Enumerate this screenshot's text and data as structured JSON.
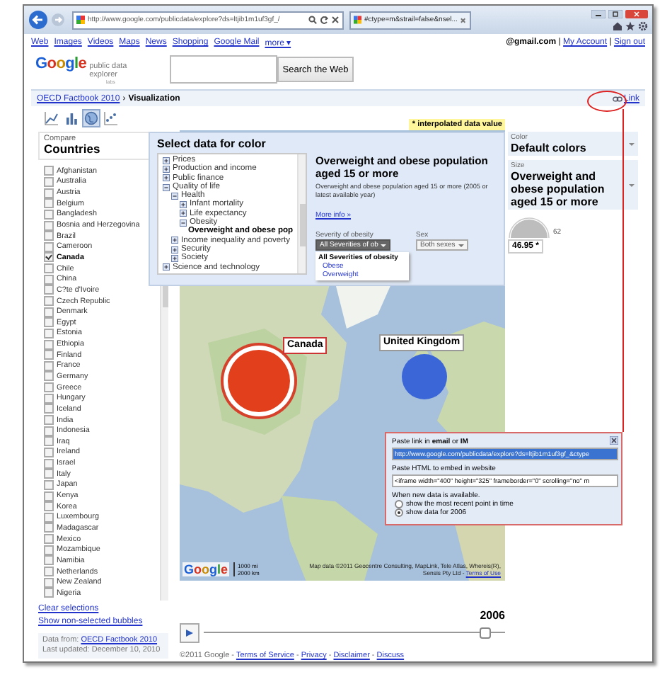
{
  "browser": {
    "address": "http://www.google.com/publicdata/explore?ds=ltjib1m1uf3gf_/",
    "tab": "#ctype=m&strail=false&nsel..."
  },
  "nav_links": [
    "Web",
    "Images",
    "Videos",
    "Maps",
    "News",
    "Shopping",
    "Google Mail",
    "more ▾"
  ],
  "account": {
    "email": "@gmail.com",
    "separator": "|",
    "links": [
      "My Account",
      "Sign out"
    ]
  },
  "header": {
    "logo": "Google",
    "product": "public data explorer",
    "badge": "labs",
    "search_button": "Search the Web"
  },
  "breadcrumb": {
    "link": "OECD Factbook 2010",
    "separator": "›",
    "current": "Visualization",
    "share_link": "Link"
  },
  "chart_types": [
    {
      "kind": "line",
      "selected": false
    },
    {
      "kind": "bar",
      "selected": false
    },
    {
      "kind": "map",
      "selected": true
    },
    {
      "kind": "scatter",
      "selected": false
    }
  ],
  "compare": {
    "label": "Compare",
    "title": "Countries"
  },
  "countries": [
    {
      "name": "Afghanistan",
      "checked": false
    },
    {
      "name": "Australia",
      "checked": false
    },
    {
      "name": "Austria",
      "checked": false
    },
    {
      "name": "Belgium",
      "checked": false
    },
    {
      "name": "Bangladesh",
      "checked": false
    },
    {
      "name": "Bosnia and Herzegovina",
      "checked": false
    },
    {
      "name": "Brazil",
      "checked": false
    },
    {
      "name": "Cameroon",
      "checked": false
    },
    {
      "name": "Canada",
      "checked": true
    },
    {
      "name": "Chile",
      "checked": false
    },
    {
      "name": "China",
      "checked": false
    },
    {
      "name": "C?te d'Ivoire",
      "checked": false
    },
    {
      "name": "Czech Republic",
      "checked": false
    },
    {
      "name": "Denmark",
      "checked": false
    },
    {
      "name": "Egypt",
      "checked": false
    },
    {
      "name": "Estonia",
      "checked": false
    },
    {
      "name": "Ethiopia",
      "checked": false
    },
    {
      "name": "Finland",
      "checked": false
    },
    {
      "name": "France",
      "checked": false
    },
    {
      "name": "Germany",
      "checked": false
    },
    {
      "name": "Greece",
      "checked": false
    },
    {
      "name": "Hungary",
      "checked": false
    },
    {
      "name": "Iceland",
      "checked": false
    },
    {
      "name": "India",
      "checked": false
    },
    {
      "name": "Indonesia",
      "checked": false
    },
    {
      "name": "Iraq",
      "checked": false
    },
    {
      "name": "Ireland",
      "checked": false
    },
    {
      "name": "Israel",
      "checked": false
    },
    {
      "name": "Italy",
      "checked": false
    },
    {
      "name": "Japan",
      "checked": false
    },
    {
      "name": "Kenya",
      "checked": false
    },
    {
      "name": "Korea",
      "checked": false
    },
    {
      "name": "Luxembourg",
      "checked": false
    },
    {
      "name": "Madagascar",
      "checked": false
    },
    {
      "name": "Mexico",
      "checked": false
    },
    {
      "name": "Mozambique",
      "checked": false
    },
    {
      "name": "Namibia",
      "checked": false
    },
    {
      "name": "Netherlands",
      "checked": false
    },
    {
      "name": "New Zealand",
      "checked": false
    },
    {
      "name": "Nigeria",
      "checked": false
    }
  ],
  "list_links": [
    "Clear selections",
    "Show non-selected bubbles"
  ],
  "source": {
    "label": "Data from:",
    "link": "OECD Factbook 2010",
    "updated": "Last updated: December 10, 2010"
  },
  "interpolated_note": "* interpolated data value",
  "data_picker": {
    "title": "Select data for color",
    "tree": [
      {
        "label": "Prices",
        "expanded": false,
        "selected": false
      },
      {
        "label": "Production and income",
        "expanded": false,
        "selected": false
      },
      {
        "label": "Public finance",
        "expanded": false,
        "selected": false
      },
      {
        "label": "Quality of life",
        "expanded": true,
        "selected": false,
        "children": [
          {
            "label": "Health",
            "expanded": true,
            "selected": false,
            "children": [
              {
                "label": "Infant mortality",
                "expanded": false,
                "selected": false
              },
              {
                "label": "Life expectancy",
                "expanded": false,
                "selected": false
              },
              {
                "label": "Obesity",
                "expanded": true,
                "selected": false,
                "children": [
                  {
                    "label": "Overweight and obese pop",
                    "selected": true
                  }
                ]
              }
            ]
          },
          {
            "label": "Income inequality and poverty",
            "expanded": false,
            "selected": false
          },
          {
            "label": "Security",
            "expanded": false,
            "selected": false
          },
          {
            "label": "Society",
            "expanded": false,
            "selected": false
          }
        ]
      },
      {
        "label": "Science and technology",
        "expanded": false,
        "selected": false
      }
    ],
    "metric_title": "Overweight and obese population aged 15 or more",
    "description": "Overweight and obese population aged 15 or more (2005 or latest available year)",
    "more_info": "More info »",
    "filters": [
      {
        "label": "Severity of obesity",
        "value": "All Severities of ob",
        "open": true
      },
      {
        "label": "Sex",
        "value": "Both sexes",
        "open": false
      }
    ],
    "options": [
      {
        "label": "All Severities of obesity",
        "selected": true
      },
      {
        "label": "Obese",
        "selected": false
      },
      {
        "label": "Overweight",
        "selected": false
      }
    ]
  },
  "bubbles": [
    {
      "label": "Canada",
      "color": "#e2401d",
      "selected": true
    },
    {
      "label": "United Kingdom",
      "color": "#3a66d8",
      "selected": false
    }
  ],
  "map": {
    "scale": [
      "1000 mi",
      "2000 km"
    ],
    "logo": "Google",
    "attribution": "Map data ©2011 Geocentre Consulting, MapLink, Tele Atlas, Whereis(R), Sensis Pty Ltd -",
    "terms": "Terms of Use"
  },
  "color_control": {
    "label": "Color",
    "value": "Default colors"
  },
  "size_control": {
    "label": "Size",
    "value": "Overweight and obese population aged 15 or more"
  },
  "size_legend": {
    "value": "46.95 *",
    "max": "62"
  },
  "share": {
    "link_label": "Paste link in **email** or **IM**",
    "link_value": "http://www.google.com/publicdata/explore?ds=ltjib1m1uf3gf_&ctype",
    "embed_label": "Paste HTML to embed in website",
    "embed_value": "<iframe width=\"400\" height=\"325\" frameborder=\"0\" scrolling=\"no\" m",
    "update_label": "When new data is available.",
    "options": [
      {
        "label": "show the most recent point in time",
        "selected": false
      },
      {
        "label": "show data for 2006",
        "selected": true
      }
    ]
  },
  "timeline": {
    "year": "2006",
    "level": 0.93
  },
  "footer": {
    "copyright": "©2011 Google",
    "separator": "-",
    "links": [
      "Terms of Service",
      "Privacy",
      "Disclaimer",
      "Discuss"
    ]
  }
}
